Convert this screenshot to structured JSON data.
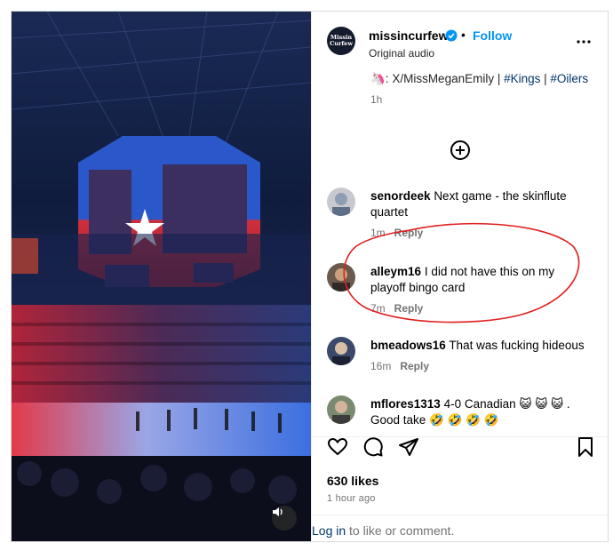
{
  "post": {
    "username": "missincurfew",
    "avatar_text": "Missin Curfew",
    "follow_label": "Follow",
    "separator": "•",
    "audio_label": "Original audio",
    "more_icon": "more-horizontal-icon"
  },
  "caption": {
    "emoji": "🦄:",
    "text": " X/MissMeganEmily | ",
    "tag1": "#Kings",
    "sep": " | ",
    "tag2": "#Oilers",
    "time": "1h"
  },
  "comments": [
    {
      "user": "senordeek",
      "text": "Next game - the skinflute quartet",
      "time": "1m",
      "reply": "Reply"
    },
    {
      "user": "alleym16",
      "text": "I did not have this on my playoff bingo card",
      "time": "7m",
      "reply": "Reply"
    },
    {
      "user": "bmeadows16",
      "text": "That was fucking hideous",
      "time": "16m",
      "reply": "Reply"
    },
    {
      "user": "mflores1313",
      "text": "4-0 Canadian 😺 😺 😺 . Good take 🤣 🤣 🤣 🤣",
      "time": "",
      "reply": ""
    }
  ],
  "actions": {
    "like_icon": "heart-icon",
    "comment_icon": "comment-icon",
    "share_icon": "share-icon",
    "save_icon": "bookmark-icon"
  },
  "likes": "630 likes",
  "time_ago": "1 hour ago",
  "footer": {
    "login": "Log in",
    "rest": " to like or comment."
  },
  "colors": {
    "link_blue": "#0095f6",
    "annotation_red": "#e02020"
  }
}
